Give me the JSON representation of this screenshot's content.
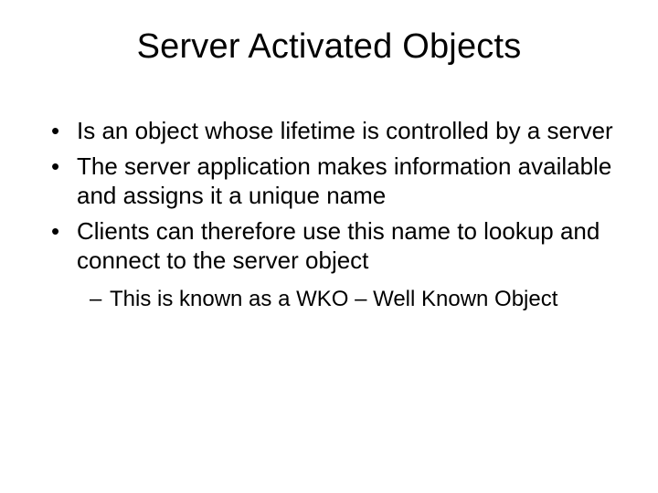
{
  "slide": {
    "title": "Server Activated Objects",
    "bullets": [
      {
        "text": "Is an object whose lifetime is controlled by a server"
      },
      {
        "text": "The server application makes information available and assigns it a unique name"
      },
      {
        "text": "Clients can therefore use this name to lookup and connect to the server object",
        "sub": [
          {
            "text": "This is known as a WKO – Well Known Object"
          }
        ]
      }
    ]
  }
}
